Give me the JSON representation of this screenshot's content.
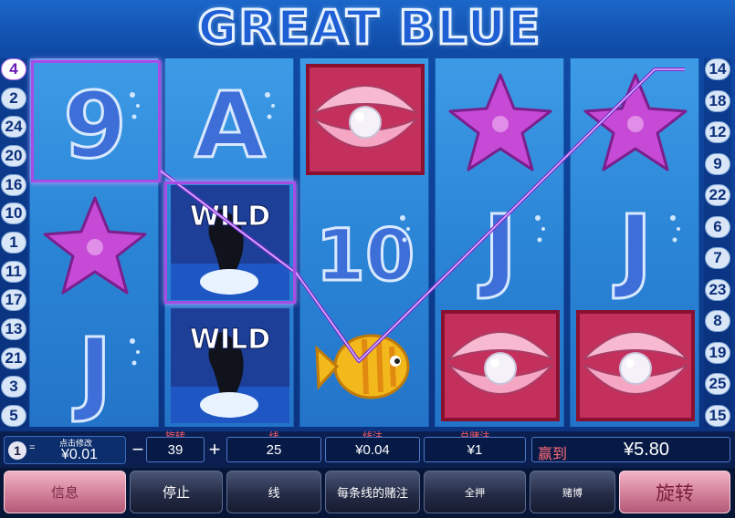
{
  "title": "GREAT BLUE",
  "left_line_numbers": [
    "4",
    "2",
    "24",
    "20",
    "16",
    "10",
    "1",
    "11",
    "17",
    "13",
    "21",
    "3",
    "5"
  ],
  "right_line_numbers": [
    "14",
    "18",
    "12",
    "9",
    "22",
    "6",
    "7",
    "23",
    "8",
    "19",
    "25",
    "15"
  ],
  "reels": [
    [
      "9",
      "starfish",
      "J"
    ],
    [
      "A",
      "WILD",
      "WILD"
    ],
    [
      "pearl-clam",
      "10",
      "fish"
    ],
    [
      "starfish",
      "J",
      "pearl-clam"
    ],
    [
      "starfish",
      "J",
      "pearl-clam"
    ]
  ],
  "win_line": 4,
  "controls": {
    "coin_badge": "1",
    "coin_eq": "=",
    "coin_hint": "点击修改",
    "coin_value": "¥0.01",
    "spin_label": "旋转",
    "spin_value": "39",
    "minus": "−",
    "plus": "+",
    "lines_label": "线",
    "lines_value": "25",
    "bet_label": "线注",
    "bet_value": "¥0.04",
    "total_bet_label": "总赌注",
    "total_bet_value": "¥1",
    "win_label": "赢到",
    "win_value": "¥5.80"
  },
  "buttons": {
    "info": "信息",
    "stop": "停止",
    "lines": "线",
    "bet_per_line": "每条线的赌注",
    "max_bet": "全押",
    "gamble": "赌博",
    "spin": "旋转"
  },
  "colors": {
    "accent_purple": "#a64de6",
    "win_red": "#ff6a78",
    "reel_blue": "#2b85d6"
  }
}
